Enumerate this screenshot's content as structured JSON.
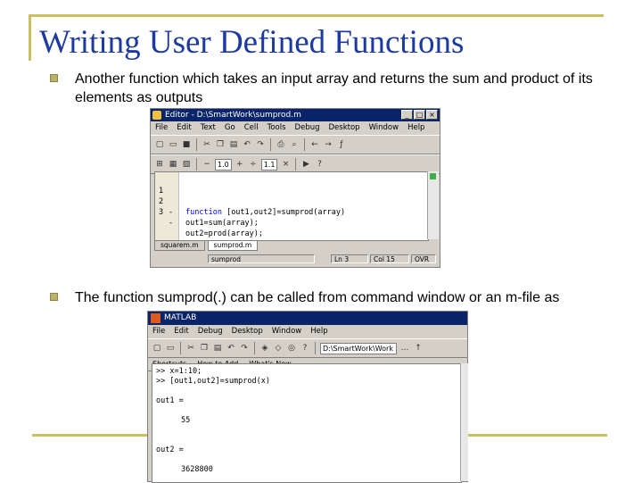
{
  "slide": {
    "title": "Writing User Defined Functions",
    "bullet1": "Another function which takes an input array and returns the sum and product of its elements as outputs",
    "bullet2": "The function sumprod(.) can be called from command window or an m-file as"
  },
  "editor": {
    "title": "Editor - D:\\SmartWork\\sumprod.m",
    "menu": [
      "File",
      "Edit",
      "Text",
      "Go",
      "Cell",
      "Tools",
      "Debug",
      "Desktop",
      "Window",
      "Help"
    ],
    "stepper1": "1.0",
    "stepper2": "1.1",
    "code": [
      {
        "num": "1",
        "dash": "",
        "keyword": "function",
        "rest": " [out1,out2]=sumprod(array)"
      },
      {
        "num": "2",
        "dash": "-",
        "keyword": "",
        "rest": "out1=sum(array);"
      },
      {
        "num": "3",
        "dash": "-",
        "keyword": "",
        "rest": "out2=prod(array);"
      }
    ],
    "tabs": [
      "squarem.m",
      "sumprod.m"
    ],
    "status_func": "sumprod",
    "status_ln": "Ln  3",
    "status_col": "Col  15",
    "status_ovr": "OVR"
  },
  "matlab": {
    "title": "MATLAB",
    "menu": [
      "File",
      "Edit",
      "Debug",
      "Desktop",
      "Window",
      "Help"
    ],
    "dir": "D:\\SmartWork\\Work",
    "shortcuts": [
      "Shortcuts",
      "How to Add",
      "What's New"
    ],
    "lines": [
      ">> x=1:10;",
      ">> [out1,out2]=sumprod(x)",
      "",
      "out1 =",
      "",
      "55",
      "",
      "",
      "out2 =",
      "",
      "3628800"
    ]
  },
  "colors": {
    "title": "#1c3aa0",
    "accent": "#c9c061",
    "titlebar": "#0a246a"
  }
}
